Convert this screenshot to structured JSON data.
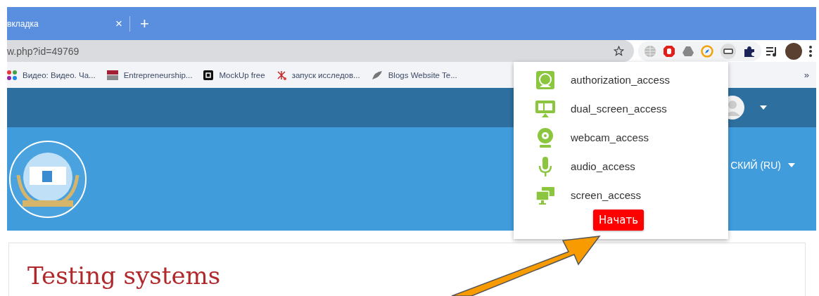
{
  "browser": {
    "tab": {
      "title": "вкладка",
      "close": "×"
    },
    "new_tab": "+",
    "address": "w.php?id=49769",
    "bookmarks": [
      {
        "label": "Видео: Видео. Ча..."
      },
      {
        "label": "Entrepreneurship..."
      },
      {
        "label": "MockUp free"
      },
      {
        "label": "запуск исследов..."
      },
      {
        "label": "Blogs Website Te..."
      }
    ],
    "bookmarks_more": "»"
  },
  "site": {
    "language": "СКИЙ (RU)",
    "page_title": "Testing systems"
  },
  "extension_popup": {
    "items": [
      {
        "label": "authorization_access"
      },
      {
        "label": "dual_screen_access"
      },
      {
        "label": "webcam_access"
      },
      {
        "label": "audio_access"
      },
      {
        "label": "screen_access"
      }
    ],
    "start_button": "Начать"
  }
}
